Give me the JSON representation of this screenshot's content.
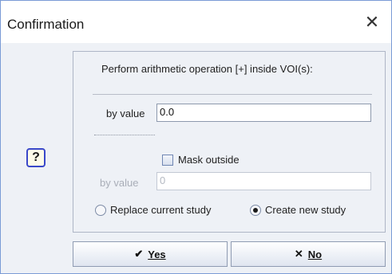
{
  "window": {
    "title": "Confirmation",
    "close_glyph": "✕"
  },
  "help": {
    "label": "?"
  },
  "panel": {
    "header": "Perform arithmetic operation [+] inside VOI(s):",
    "by_value_label": "by value",
    "by_value": "0.0",
    "mask_outside_label": "Mask outside",
    "mask_outside_checked": false,
    "mask_by_value_label": "by value",
    "mask_by_value": "0"
  },
  "radios": [
    {
      "label": "Replace current study",
      "selected": false
    },
    {
      "label": "Create new study",
      "selected": true
    }
  ],
  "buttons": {
    "yes": {
      "icon_glyph": "✔",
      "label": "Yes",
      "icon": "checkmark-icon"
    },
    "no": {
      "icon_glyph": "✕",
      "label": "No",
      "icon": "cross-icon"
    }
  },
  "colors": {
    "accent": "#3a48c9",
    "border": "#7a9bd6"
  }
}
